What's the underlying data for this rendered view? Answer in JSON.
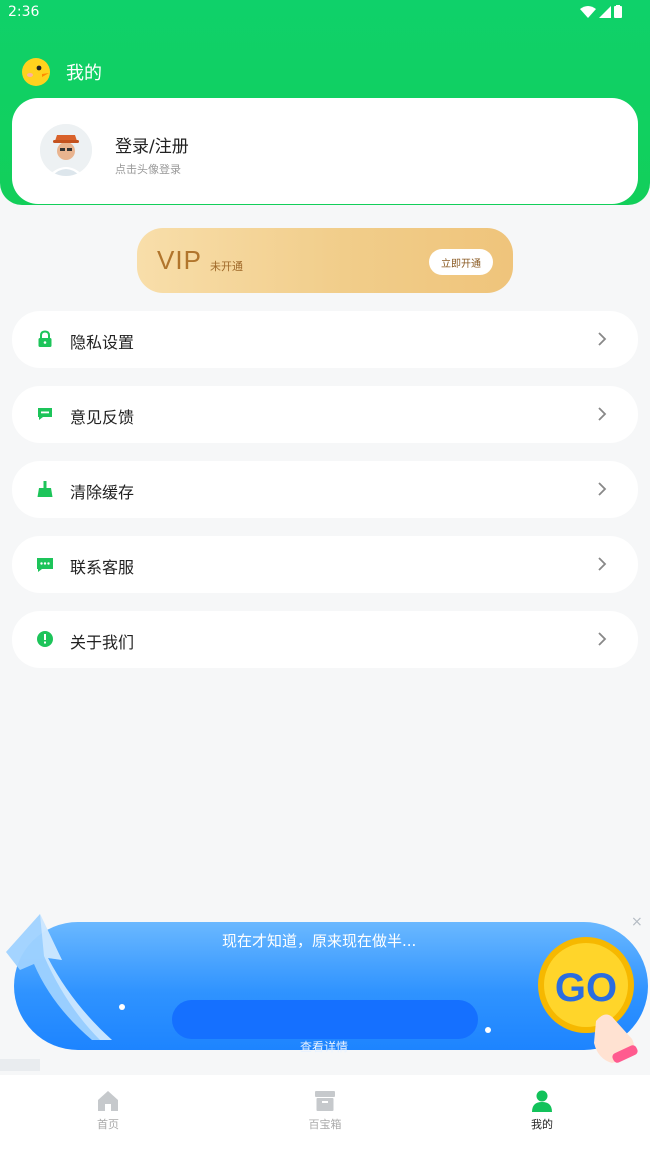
{
  "status_bar": {
    "time": "2:36"
  },
  "header": {
    "title": "我的"
  },
  "profile": {
    "title": "登录/注册",
    "subtitle": "点击头像登录"
  },
  "vip": {
    "label": "VIP",
    "status": "未开通",
    "button": "立即开通"
  },
  "menu": [
    {
      "label": "隐私设置",
      "icon": "lock-icon"
    },
    {
      "label": "意见反馈",
      "icon": "message-icon"
    },
    {
      "label": "清除缓存",
      "icon": "broom-icon"
    },
    {
      "label": "联系客服",
      "icon": "chat-icon"
    },
    {
      "label": "关于我们",
      "icon": "info-icon"
    }
  ],
  "ad": {
    "text": "现在才知道，原来现在做半...",
    "button": "查看详情",
    "badge": "GO",
    "close": "×"
  },
  "bottom_nav": [
    {
      "label": "首页",
      "icon": "home-icon"
    },
    {
      "label": "百宝箱",
      "icon": "box-icon"
    },
    {
      "label": "我的",
      "icon": "person-icon",
      "active": true
    }
  ],
  "colors": {
    "primary_green": "#12cf5a",
    "vip_gold": "#f1cd8a",
    "ad_blue": "#2f93ff"
  }
}
